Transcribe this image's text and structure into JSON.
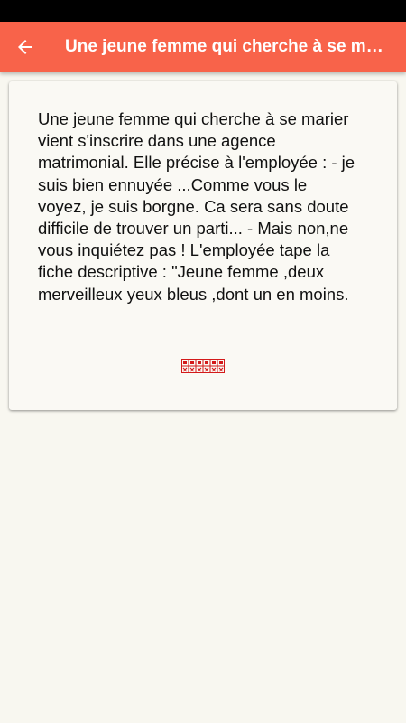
{
  "status_bar": {},
  "toolbar": {
    "title": "Une jeune femme qui cherche à se marier",
    "back_icon": "arrow-left-icon",
    "background_color": "#f8634a"
  },
  "joke": {
    "body": "Une jeune femme qui cherche à se marier vient s'inscrire dans une agence matrimonial. Elle précise à l'employée : - je suis bien ennuyée ...Comme vous le voyez, je suis borgne. Ca sera sans doute difficile de trouver un parti... - Mais non,ne vous inquiétez pas ! L'employée tape la fiche descriptive : \"Jeune femme ,deux merveilleux yeux bleus ,dont un en moins."
  },
  "decoration": {
    "icon": "red-pattern-icon",
    "color": "#d31a1a"
  }
}
